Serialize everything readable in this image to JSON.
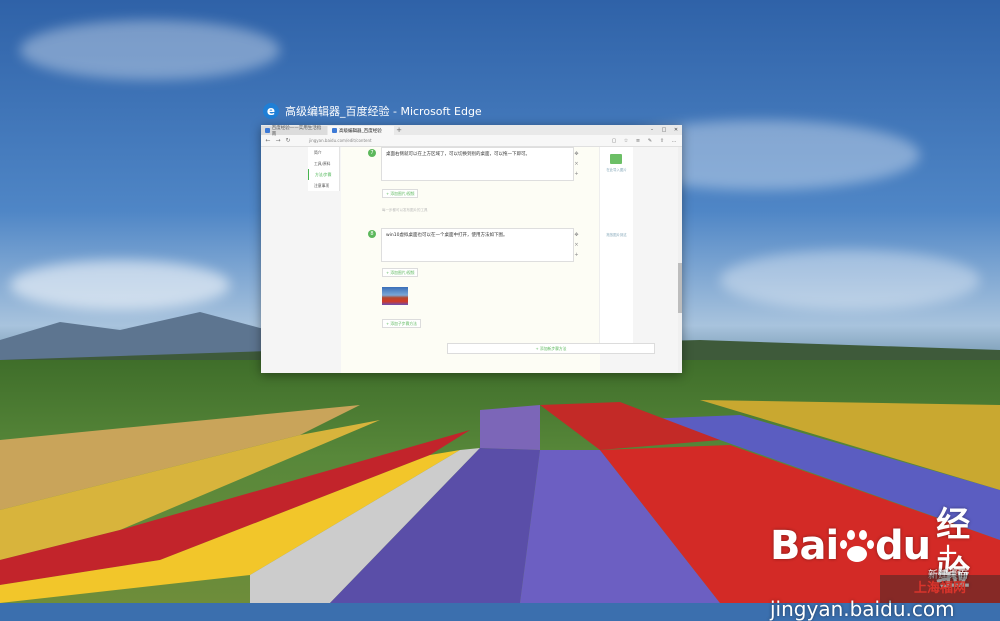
{
  "window": {
    "title": "高级编辑器_百度经验 - Microsoft Edge",
    "app_icon": "edge-icon",
    "tabs": [
      {
        "label": "百度经验——实用生活指南"
      },
      {
        "label": "高级编辑器_百度经验"
      }
    ],
    "new_tab": "+",
    "controls": {
      "minimize": "–",
      "maximize": "□",
      "close": "✕"
    },
    "address": "jingyan.baidu.com/edit/content"
  },
  "left_menu": {
    "items": [
      "简介",
      "工具/原料",
      "方法/步骤",
      "注意事项"
    ],
    "active_index": 2
  },
  "steps": [
    {
      "num": "7",
      "text": "桌面右侧就可以在上方区域了，可以切换到别的桌面，可以拖一下即可。"
    },
    {
      "num": "8",
      "text": "win10虚拟桌面也可以在一个桌面中打开，使用方法如下图。"
    }
  ],
  "buttons": {
    "add_image": "+ 添加图片/视频",
    "add_substep": "+ 添加子步骤方法",
    "add_step": "+ 添加新步骤方法",
    "hint": "每一步都可以发布图片的工具"
  },
  "right_panel": {
    "label": "在此导入图片",
    "label2": "拖放图片到这"
  },
  "watermark": {
    "brand_left": "Bai",
    "brand_right": "du",
    "brand_cn": "经验",
    "url": "jingyan.baidu.com"
  },
  "task_view": {
    "new_desktop_plus": "+",
    "new_desktop_label": "新建桌面"
  },
  "corner_mark": "上海福网"
}
